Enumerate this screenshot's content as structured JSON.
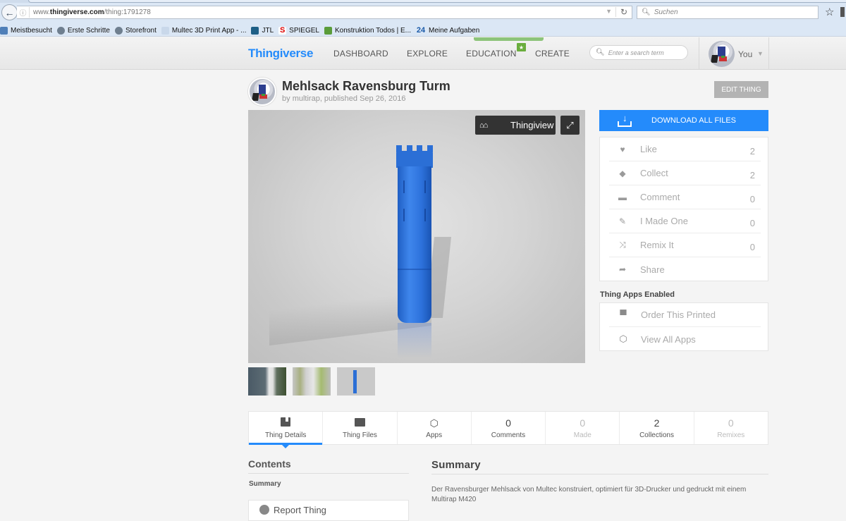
{
  "browser": {
    "url_prefix": "www.",
    "url_domain": "thingiverse.com",
    "url_path": "/thing:1791278",
    "search_placeholder": "Suchen",
    "bookmarks": [
      {
        "label": "Meistbesucht",
        "icon": "folder-icon"
      },
      {
        "label": "Erste Schritte",
        "icon": "globe-icon"
      },
      {
        "label": "Storefront",
        "icon": "globe-icon"
      },
      {
        "label": "Multec 3D Print App - ...",
        "icon": "page-icon"
      },
      {
        "label": "JTL",
        "icon": "jtl-icon"
      },
      {
        "label": "SPIEGEL",
        "icon": "spiegel-icon"
      },
      {
        "label": "Konstruktion Todos | E...",
        "icon": "evernote-icon"
      },
      {
        "label": "Meine Aufgaben",
        "icon": "24-icon"
      }
    ],
    "bookmark_glyphs": {
      "spiegel": "S",
      "n24": "24"
    }
  },
  "header": {
    "logo": "Thingiverse",
    "nav": [
      "DASHBOARD",
      "EXPLORE",
      "EDUCATION",
      "CREATE"
    ],
    "education_badge": "★",
    "search_placeholder": "Enter a search term",
    "user_label": "You"
  },
  "thing": {
    "title": "Mehlsack Ravensburg Turm",
    "byline_prefix": "by ",
    "author": "multirap",
    "published": ", published Sep 26, 2016",
    "edit_label": "EDIT THING",
    "viewer_button": "Thingiview",
    "model_color": "#2b6fd6"
  },
  "sidebar": {
    "download_label": "DOWNLOAD ALL FILES",
    "actions": [
      {
        "label": "Like",
        "count": "2",
        "icon": "heart-icon"
      },
      {
        "label": "Collect",
        "count": "2",
        "icon": "collect-icon"
      },
      {
        "label": "Comment",
        "count": "0",
        "icon": "comment-icon"
      },
      {
        "label": "I Made One",
        "count": "0",
        "icon": "made-icon"
      },
      {
        "label": "Remix It",
        "count": "0",
        "icon": "shuffle-icon"
      },
      {
        "label": "Share",
        "count": "",
        "icon": "share-icon"
      }
    ],
    "apps_heading": "Thing Apps Enabled",
    "apps": [
      {
        "label": "Order This Printed",
        "icon": "printer-icon"
      },
      {
        "label": "View All Apps",
        "icon": "cube-icon"
      }
    ]
  },
  "tabs": [
    {
      "label": "Thing Details",
      "icon": "book-icon",
      "active": true
    },
    {
      "label": "Thing Files",
      "icon": "folder-icon"
    },
    {
      "label": "Apps",
      "icon": "cube-icon"
    },
    {
      "label": "Comments",
      "count": "0"
    },
    {
      "label": "Made",
      "count": "0"
    },
    {
      "label": "Collections",
      "count": "2"
    },
    {
      "label": "Remixes",
      "count": "0"
    }
  ],
  "contents": {
    "title": "Contents",
    "links": [
      "Summary"
    ],
    "report_label": "Report Thing"
  },
  "summary": {
    "title": "Summary",
    "text": "Der Ravensburger Mehlsack von Multec konstruiert, optimiert für 3D-Drucker und gedruckt mit einem Multirap M420"
  },
  "colors": {
    "brand_blue": "#248bfb",
    "education_green": "#6aad3d"
  }
}
